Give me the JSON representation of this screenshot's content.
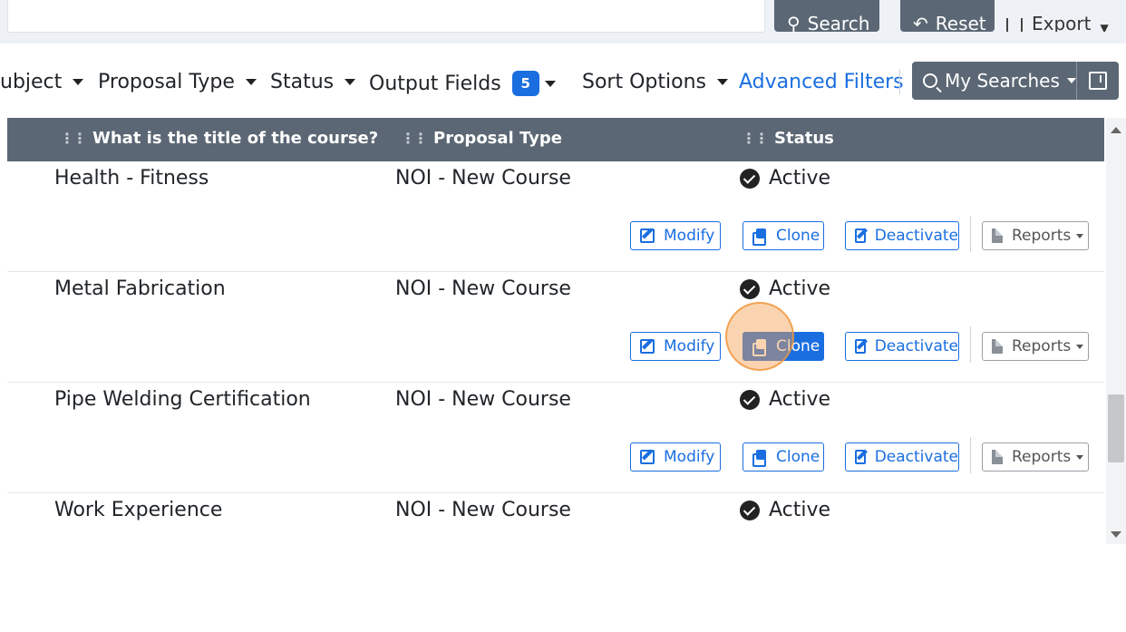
{
  "toolbar": {
    "search_label": "Search",
    "reset_label": "Reset",
    "export_label": "Export"
  },
  "filters": {
    "subject_label": "ubject",
    "proposal_type_label": "Proposal Type",
    "status_label": "Status",
    "output_fields_label": "Output Fields",
    "output_fields_count": "5",
    "sort_options_label": "Sort Options",
    "advanced_filters_label": "Advanced Filters",
    "my_searches_label": "My Searches"
  },
  "table": {
    "columns": [
      "What is the title of the course?",
      "Proposal Type",
      "Status"
    ],
    "rows": [
      {
        "title": "Health - Fitness",
        "type": "NOI - New Course",
        "status": "Active"
      },
      {
        "title": "Metal Fabrication",
        "type": "NOI - New Course",
        "status": "Active"
      },
      {
        "title": "Pipe Welding Certification",
        "type": "NOI - New Course",
        "status": "Active"
      },
      {
        "title": "Work Experience",
        "type": "NOI - New Course",
        "status": "Active"
      }
    ],
    "actions": {
      "modify": "Modify",
      "clone": "Clone",
      "deactivate": "Deactivate",
      "reports": "Reports"
    }
  },
  "colors": {
    "accent": "#1a6ee0",
    "header_bg": "#5b6774",
    "highlight": "#f5a050"
  }
}
